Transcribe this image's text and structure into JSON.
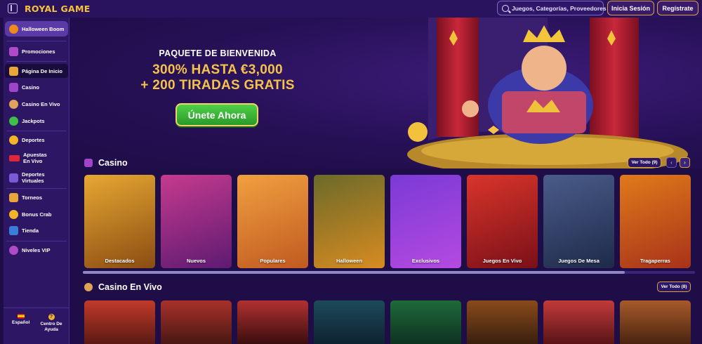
{
  "header": {
    "logo": "ROYAL GAME",
    "search_placeholder": "Juegos, Categorías, Proveedores",
    "login": "Inicia Sesión",
    "register": "Regístrate"
  },
  "sidebar": {
    "items": [
      {
        "label": "Halloween Boom",
        "icon": "pumpkin-icon"
      },
      {
        "label": "Promociones",
        "icon": "gift-icon"
      },
      {
        "label": "Página De Inicio",
        "icon": "home-icon"
      },
      {
        "label": "Casino",
        "icon": "slot-machine-icon"
      },
      {
        "label": "Casino En Vivo",
        "icon": "dealer-icon"
      },
      {
        "label": "Jackpots",
        "icon": "clover-icon"
      },
      {
        "label": "Deportes",
        "icon": "soccer-ball-icon"
      },
      {
        "label": "Apuestas En Vivo",
        "icon": "live-badge-icon"
      },
      {
        "label": "Deportes Virtuales",
        "icon": "virtual-sports-icon"
      },
      {
        "label": "Torneos",
        "icon": "trophy-icon"
      },
      {
        "label": "Bonus Crab",
        "icon": "crab-claw-icon"
      },
      {
        "label": "Tienda",
        "icon": "shop-icon"
      },
      {
        "label": "Niveles VIP",
        "icon": "vip-icon"
      }
    ],
    "language": "Español",
    "help": "Centro De Ayuda"
  },
  "hero": {
    "kicker": "PAQUETE DE BIENVENIDA",
    "line1": "300% HASTA €3,000",
    "line2": "+ 200 TIRADAS GRATIS",
    "cta": "Únete Ahora"
  },
  "casino_section": {
    "title": "Casino",
    "view_all": "Ver Todo",
    "view_all_count": "(9)",
    "cards": [
      {
        "label": "Destacados"
      },
      {
        "label": "Nuevos"
      },
      {
        "label": "Populares"
      },
      {
        "label": "Halloween"
      },
      {
        "label": "Exclusivos"
      },
      {
        "label": "Juegos En Vivo"
      },
      {
        "label": "Juegos De Mesa"
      },
      {
        "label": "Tragaperras"
      }
    ]
  },
  "live_section": {
    "title": "Casino En Vivo",
    "view_all": "Ver Todo",
    "view_all_count": "(8)"
  },
  "colors": {
    "background": "#1e0d47",
    "header": "#2a135e",
    "sidebar": "#2d1663",
    "gold": "#f6c34a",
    "cta_green": "#3cb83a"
  }
}
